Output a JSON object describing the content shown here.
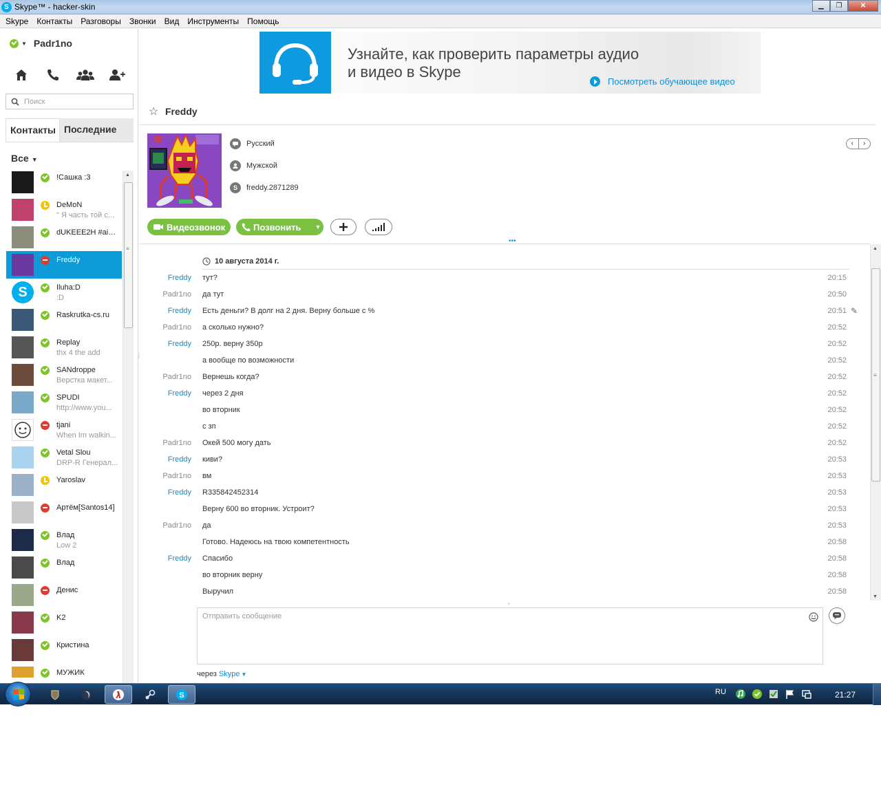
{
  "window": {
    "title": "Skype™ - hacker-skin",
    "app_icon_letter": "S",
    "minimize": "▁",
    "maximize": "❐",
    "close": "✕"
  },
  "menu": [
    "Skype",
    "Контакты",
    "Разговоры",
    "Звонки",
    "Вид",
    "Инструменты",
    "Помощь"
  ],
  "profile": {
    "name": "Padr1no",
    "status": "online"
  },
  "nav_icons": [
    "home-icon",
    "phone-icon",
    "group-icon",
    "add-contact-icon"
  ],
  "search": {
    "placeholder": "Поиск"
  },
  "tabs": {
    "contacts": "Контакты",
    "recent": "Последние"
  },
  "filter": {
    "label": "Все"
  },
  "contacts": [
    {
      "name": "!Сашка :3",
      "mood": "",
      "status": "online",
      "avatar_color": "#1a1a1a",
      "selected": false
    },
    {
      "name": "DeMoN",
      "mood": "\" Я часть той с...",
      "status": "away",
      "avatar_color": "#c0406e",
      "selected": false
    },
    {
      "name": "dUKEEE2H #aim...",
      "mood": "",
      "status": "online",
      "avatar_color": "#8c8c7a",
      "selected": false
    },
    {
      "name": "Freddy",
      "mood": "",
      "status": "busy",
      "avatar_color": "#6a3aa0",
      "selected": true
    },
    {
      "name": "Iluha:D",
      "mood": ":D",
      "status": "online",
      "avatar_color": "#00aff0",
      "selected": false
    },
    {
      "name": "Raskrutka-cs.ru",
      "mood": "",
      "status": "online",
      "avatar_color": "#3a5a7a",
      "selected": false
    },
    {
      "name": "Replay",
      "mood": "thx 4 the add",
      "status": "online",
      "avatar_color": "#555555",
      "selected": false
    },
    {
      "name": "SANdroppe",
      "mood": "Верстка макет...",
      "status": "online",
      "avatar_color": "#6b4b3a",
      "selected": false
    },
    {
      "name": "SPUDI",
      "mood": "http://www.you...",
      "status": "online",
      "avatar_color": "#7aa8c8",
      "selected": false
    },
    {
      "name": "tjani",
      "mood": "When Im walkin...",
      "status": "busy",
      "avatar_color": "#ffffff",
      "selected": false
    },
    {
      "name": "Vetal Slou",
      "mood": "DRP-R Генерал...",
      "status": "online",
      "avatar_color": "#a9d3ef",
      "selected": false
    },
    {
      "name": "Yaroslav",
      "mood": "",
      "status": "away",
      "avatar_color": "#9ab0c8",
      "selected": false
    },
    {
      "name": "Артём[Santos14]",
      "mood": "",
      "status": "busy",
      "avatar_color": "#c8c8c8",
      "selected": false
    },
    {
      "name": "Влад",
      "mood": "Low 2",
      "status": "online",
      "avatar_color": "#1d2a4a",
      "selected": false
    },
    {
      "name": "Влад",
      "mood": "",
      "status": "online",
      "avatar_color": "#4a4a4a",
      "selected": false
    },
    {
      "name": "Денис",
      "mood": "",
      "status": "busy",
      "avatar_color": "#9aa88a",
      "selected": false
    },
    {
      "name": "K2",
      "mood": "",
      "status": "online",
      "avatar_color": "#8a3a4a",
      "selected": false
    },
    {
      "name": "Кристина",
      "mood": "",
      "status": "online",
      "avatar_color": "#6a3a3a",
      "selected": false
    },
    {
      "name": "МУЖИК",
      "mood": "",
      "status": "online",
      "avatar_color": "#e0a030",
      "selected": false
    }
  ],
  "banner": {
    "text_line1": "Узнайте, как проверить параметры аудио",
    "text_line2": "и видео в Skype",
    "link": "Посмотреть обучающее видео"
  },
  "chat": {
    "contact_name": "Freddy",
    "profile": {
      "language": "Русский",
      "gender": "Мужской",
      "skype_name": "freddy.2871289"
    },
    "actions": {
      "video_call": "Видеозвонок",
      "call": "Позвонить"
    },
    "dots": "•••",
    "date": "10 августа 2014 г.",
    "messages": [
      {
        "author": "Freddy",
        "me": false,
        "text": "тут?",
        "time": "20:15"
      },
      {
        "author": "Padr1no",
        "me": true,
        "text": "да тут",
        "time": "20:50"
      },
      {
        "author": "Freddy",
        "me": false,
        "text": "Есть деньги? В долг на 2 дня. Верну больше с %",
        "time": "20:51"
      },
      {
        "author": "Padr1no",
        "me": true,
        "text": "а сколько нужно?",
        "time": "20:52"
      },
      {
        "author": "Freddy",
        "me": false,
        "text": "250р. верну 350р",
        "time": "20:52"
      },
      {
        "author": "",
        "me": false,
        "text": "а вообще по возможности",
        "time": "20:52"
      },
      {
        "author": "Padr1no",
        "me": true,
        "text": "Вернешь когда?",
        "time": "20:52"
      },
      {
        "author": "Freddy",
        "me": false,
        "text": "через 2 дня",
        "time": "20:52"
      },
      {
        "author": "",
        "me": false,
        "text": "во вторник",
        "time": "20:52"
      },
      {
        "author": "",
        "me": false,
        "text": "с зп",
        "time": "20:52"
      },
      {
        "author": "Padr1no",
        "me": true,
        "text": "Окей 500 могу дать",
        "time": "20:52"
      },
      {
        "author": "Freddy",
        "me": false,
        "text": "киви?",
        "time": "20:53"
      },
      {
        "author": "Padr1no",
        "me": true,
        "text": "вм",
        "time": "20:53"
      },
      {
        "author": "Freddy",
        "me": false,
        "text": "R335842452314",
        "time": "20:53"
      },
      {
        "author": "",
        "me": false,
        "text": "Верну 600 во вторник. Устроит?",
        "time": "20:53"
      },
      {
        "author": "Padr1no",
        "me": true,
        "text": "да",
        "time": "20:53"
      },
      {
        "author": "",
        "me": true,
        "text": "Готово. Надеюсь на твою компетентность",
        "time": "20:58"
      },
      {
        "author": "Freddy",
        "me": false,
        "text": "Спасибо",
        "time": "20:58"
      },
      {
        "author": "",
        "me": false,
        "text": "во вторник верну",
        "time": "20:58"
      },
      {
        "author": "",
        "me": false,
        "text": "Выручил",
        "time": "20:58"
      }
    ],
    "compose_placeholder": "Отправить сообщение",
    "via_prefix": "через",
    "via_link": "Skype"
  },
  "taskbar": {
    "language": "RU",
    "clock": "21:27",
    "apps": [
      "world-of-tanks-icon",
      "dota-icon",
      "yandex-browser-icon",
      "steam-icon",
      "skype-icon"
    ],
    "active_app": "skype-icon"
  },
  "colors": {
    "accent": "#0d9ad8",
    "green": "#7ac142",
    "online": "#7ec526",
    "away": "#f5c400",
    "busy": "#e23b2e"
  }
}
